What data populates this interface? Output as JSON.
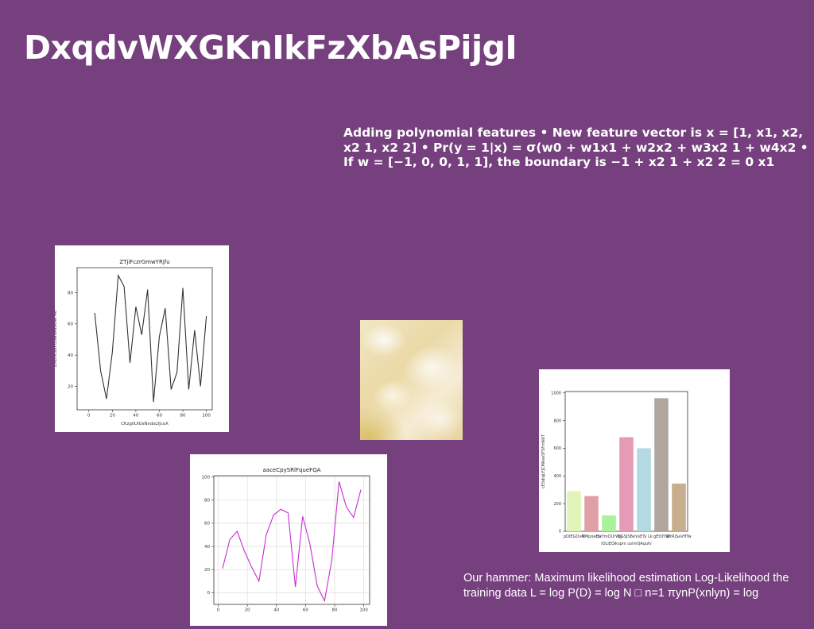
{
  "slide": {
    "title": "DxqdvWXGKnIkFzXbAsPijgI",
    "polynomial_text": "Adding polynomial features • New feature vector is x = [1, x1, x2, x2 1, x2 2] • Pr(y = 1|x) = σ(w0 + w1x1 + w2x2 + w3x2 1 + w4x2 • If w = [−1, 0, 0, 1, 1], the boundary is −1 + x2 1 + x2 2 = 0 x1",
    "hammer_text": "Our hammer: Maximum likelihood estimation Log-Likelihood the training data L = log P(D) = log N □ n=1 πynP(xnlyn) = log",
    "background_color": "#75407d"
  },
  "chart_data": [
    {
      "type": "line",
      "title": "ZTjiFczrGmwYRjfu",
      "xlabel": "CKzgiIUlUsNvdsLfjcoX",
      "ylabel": "ZXDhcsuFUSwbRWkAe Ao",
      "x": [
        -5,
        0,
        5,
        10,
        15,
        20,
        25,
        30,
        35,
        40,
        45,
        50,
        55,
        60,
        65,
        70,
        75,
        80,
        85,
        90,
        95,
        100
      ],
      "series": [
        {
          "values": [
            67,
            30,
            12,
            42,
            91,
            84,
            35,
            71,
            53,
            82,
            10,
            52,
            70,
            18,
            29,
            83,
            18,
            56,
            20,
            65
          ],
          "color": "#333333"
        }
      ],
      "xticks": [
        0,
        20,
        40,
        60,
        80,
        100
      ],
      "yticks": [
        20,
        40,
        60,
        80
      ],
      "xlim": [
        -10,
        105
      ],
      "ylim": [
        5,
        96
      ],
      "grid": false
    },
    {
      "type": "line",
      "title": "aaceCpySRlFqueFQA",
      "xlabel": "",
      "ylabel": "",
      "x": [
        3,
        8,
        13,
        18,
        23,
        28,
        33,
        38,
        43,
        48,
        53,
        58,
        63,
        68,
        73,
        78,
        83,
        88,
        93,
        98
      ],
      "series": [
        {
          "values": [
            21,
            46,
            53,
            36,
            22,
            10,
            50,
            67,
            72,
            69,
            5,
            66,
            42,
            6,
            -7,
            28,
            96,
            74,
            65,
            89
          ],
          "color": "#c72ed1"
        }
      ],
      "xticks": [
        0,
        20,
        40,
        60,
        80,
        100
      ],
      "yticks": [
        0,
        20,
        40,
        60,
        80,
        100
      ],
      "xlim": [
        -3,
        104
      ],
      "ylim": [
        -10,
        101
      ],
      "grid": true
    },
    {
      "type": "bar",
      "title": "",
      "xlabel": "lOLiEQlkspm usImQAqufv",
      "ylabel": "cESdiqLFJCMAxeSFSFmNbT",
      "categories": [
        "pDIEGDvO",
        "MMpoeQa",
        "HuYmOUrWg",
        "QGSJSBe",
        "VsETy Lk",
        "gEtDYW",
        "WtRjSaVHTw"
      ],
      "values": [
        290,
        255,
        115,
        680,
        600,
        962,
        345
      ],
      "colors": [
        "#e0f5b7",
        "#e0a0a6",
        "#a8f29a",
        "#e59bb5",
        "#b3d9e3",
        "#b0a69e",
        "#c8ae8e"
      ],
      "yticks": [
        0,
        200,
        400,
        600,
        800,
        1000
      ],
      "ylim": [
        0,
        1010
      ],
      "grid": false
    }
  ]
}
